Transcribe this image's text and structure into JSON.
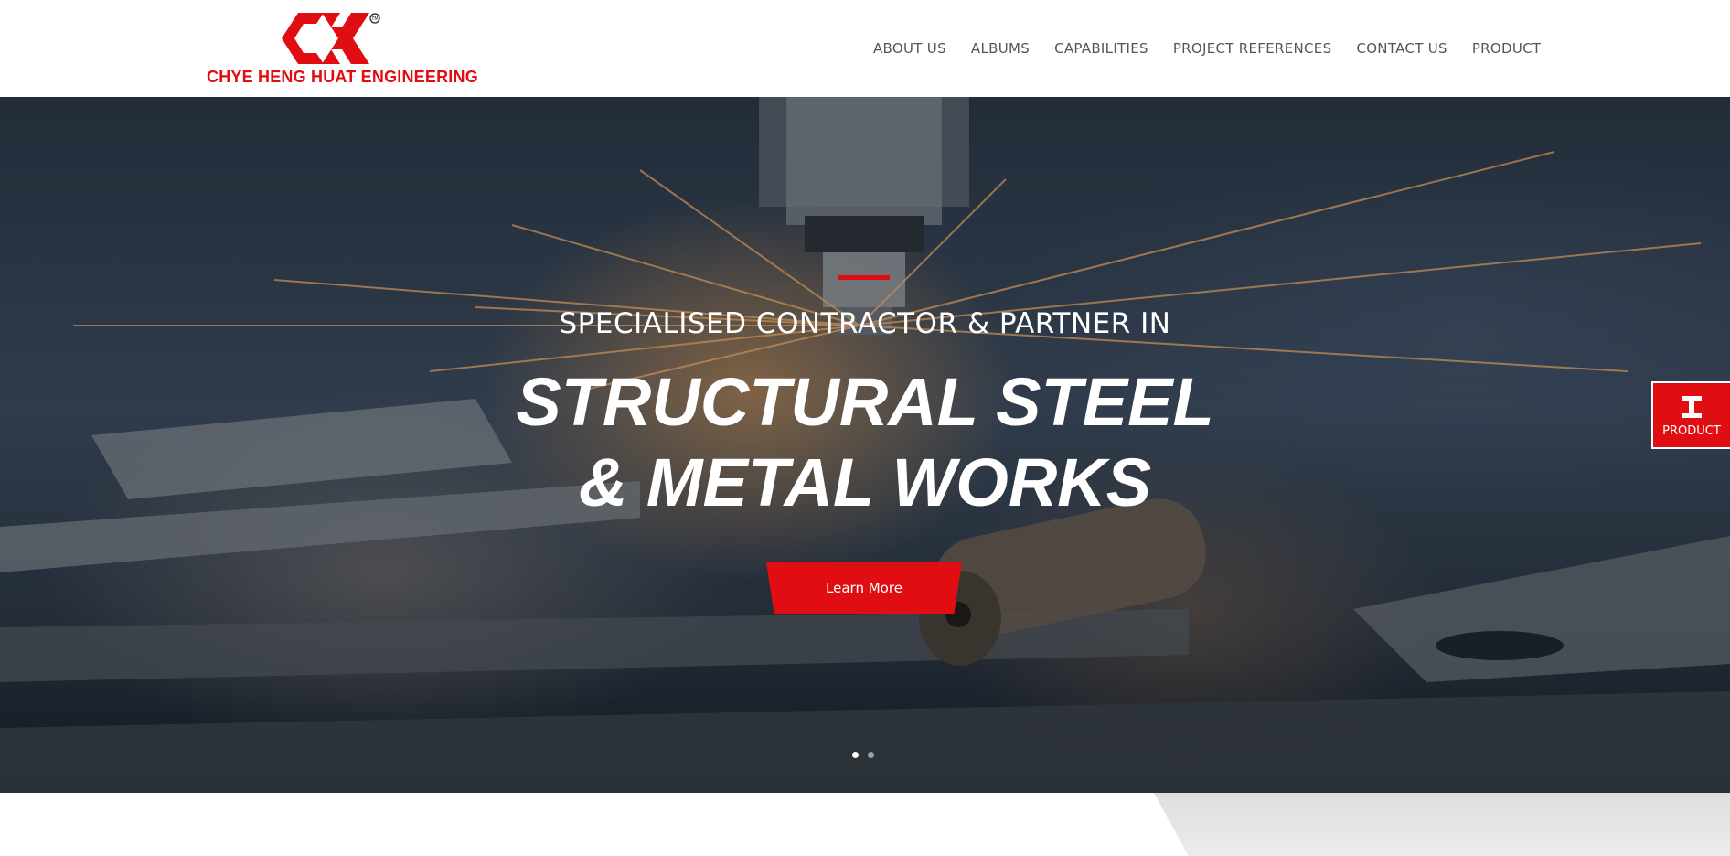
{
  "brand": {
    "name": "CHYE HENG HUAT ENGINEERING",
    "trademark": "TM",
    "accent_color": "#e00d12"
  },
  "nav": {
    "items": [
      {
        "label": "ABOUT US"
      },
      {
        "label": "ALBUMS"
      },
      {
        "label": "CAPABILITIES"
      },
      {
        "label": "PROJECT REFERENCES"
      },
      {
        "label": "CONTACT US"
      },
      {
        "label": "PRODUCT"
      }
    ]
  },
  "hero": {
    "eyebrow": "SPECIALISED CONTRACTOR & PARTNER IN",
    "title_line1": "STRUCTURAL STEEL",
    "title_line2": "& METAL WORKS",
    "button_label": "Learn More",
    "slides_total": 2,
    "active_slide": 1
  },
  "side_tab": {
    "label": "PRODUCT",
    "icon": "steel-beam-icon"
  }
}
